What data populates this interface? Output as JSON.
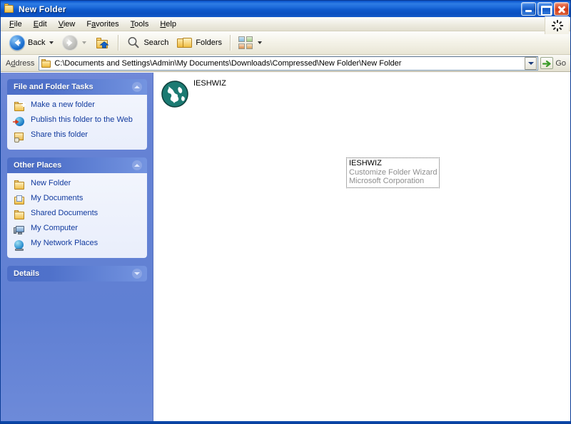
{
  "window": {
    "title": "New Folder",
    "folder_icon": "folder-icon",
    "controls": {
      "minimize": "minimize-button",
      "maximize": "maximize-button",
      "close": "close-button"
    }
  },
  "menubar": {
    "items": [
      {
        "label": "File",
        "accel": "F"
      },
      {
        "label": "Edit",
        "accel": "E"
      },
      {
        "label": "View",
        "accel": "V"
      },
      {
        "label": "Favorites",
        "accel": "a"
      },
      {
        "label": "Tools",
        "accel": "T"
      },
      {
        "label": "Help",
        "accel": "H"
      }
    ],
    "throbber": "windows-throbber-icon"
  },
  "toolbar": {
    "back_label": "Back",
    "back_icon": "back-arrow-icon",
    "forward_icon": "forward-arrow-icon",
    "up_icon": "up-folder-icon",
    "search_label": "Search",
    "search_icon": "magnifier-icon",
    "folders_label": "Folders",
    "folders_icon": "folders-icon",
    "views_icon": "views-icon"
  },
  "address": {
    "label": "Address",
    "path": "C:\\Documents and Settings\\Admin\\My Documents\\Downloads\\Compressed\\New Folder\\New Folder",
    "folder_icon": "folder-icon",
    "dropdown_icon": "chevron-down-icon",
    "go_label": "Go",
    "go_icon": "green-arrow-icon"
  },
  "sidebar": {
    "panels": [
      {
        "title": "File and Folder Tasks",
        "collapsed": false,
        "chevron": "chevron-up-icon",
        "items": [
          {
            "label": "Make a new folder",
            "icon": "new-folder-icon"
          },
          {
            "label": "Publish this folder to the Web",
            "icon": "publish-web-icon"
          },
          {
            "label": "Share this folder",
            "icon": "share-folder-icon"
          }
        ]
      },
      {
        "title": "Other Places",
        "collapsed": false,
        "chevron": "chevron-up-icon",
        "items": [
          {
            "label": "New Folder",
            "icon": "folder-icon"
          },
          {
            "label": "My Documents",
            "icon": "my-documents-icon"
          },
          {
            "label": "Shared Documents",
            "icon": "shared-documents-icon"
          },
          {
            "label": "My Computer",
            "icon": "my-computer-icon"
          },
          {
            "label": "My Network Places",
            "icon": "my-network-places-icon"
          }
        ]
      },
      {
        "title": "Details",
        "collapsed": true,
        "chevron": "chevron-down-icon",
        "items": []
      }
    ]
  },
  "content": {
    "files": [
      {
        "name": "IESHWIZ",
        "icon": "globe-icon"
      }
    ],
    "tooltip": {
      "name": "IESHWIZ",
      "description": "Customize Folder Wizard",
      "company": "Microsoft Corporation"
    }
  },
  "colors": {
    "title_blue": "#0a50c8",
    "sidebar_blue": "#6683d4",
    "panel_header": "#4f71ca",
    "link_blue": "#113a9e",
    "globe_teal": "#1b7a72",
    "close_red": "#d63a15",
    "go_green": "#3a9b28"
  }
}
